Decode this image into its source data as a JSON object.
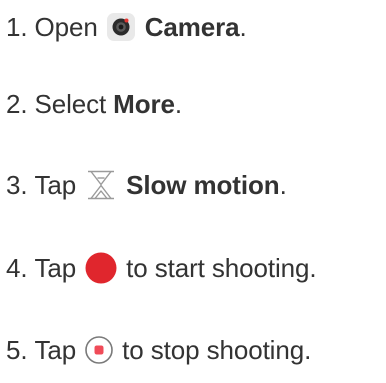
{
  "steps": [
    {
      "number": "1.",
      "pre": "Open",
      "bold": "Camera",
      "post": ".",
      "icon": "camera-app-icon"
    },
    {
      "number": "2.",
      "pre": "Select",
      "bold": "More",
      "post": "."
    },
    {
      "number": "3.",
      "pre": "Tap",
      "bold": "Slow motion",
      "post": ".",
      "icon": "hourglass-icon"
    },
    {
      "number": "4.",
      "pre": "Tap",
      "post": "to start shooting.",
      "icon": "record-button-icon"
    },
    {
      "number": "5.",
      "pre": "Tap",
      "post": "to stop shooting.",
      "icon": "stop-button-icon"
    }
  ],
  "colors": {
    "text": "#333333",
    "record_red": "#e0262d",
    "stop_red": "#f04b58",
    "icon_gray": "#9a9a9a"
  }
}
